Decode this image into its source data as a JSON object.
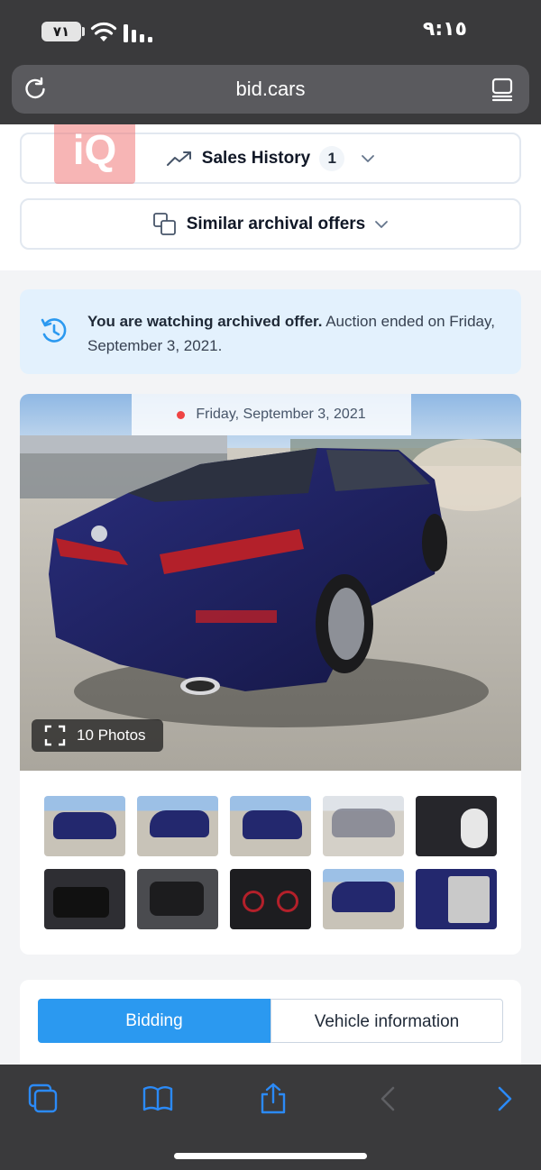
{
  "status_bar": {
    "time": "٩:١٥",
    "battery": "٧١"
  },
  "browser": {
    "url": "bid.cars"
  },
  "watermark": {
    "text": "iQ"
  },
  "sales_history": {
    "label": "Sales History",
    "count": "1"
  },
  "similar_offers": {
    "label": "Similar archival offers"
  },
  "notice": {
    "bold": "You are watching archived offer.",
    "text": " Auction ended on Friday, September 3, 2021."
  },
  "listing": {
    "date": "Friday, September 3, 2021",
    "photos_label": "10 Photos"
  },
  "tabs": [
    {
      "label": "Bidding",
      "active": true
    },
    {
      "label": "Vehicle information",
      "active": false
    }
  ],
  "colors": {
    "accent": "#2b99f0",
    "notice_bg": "#e3f1fd",
    "chrome": "#3a3a3c",
    "ios_blue": "#2b8af7"
  },
  "toolbar": {
    "icons": [
      "tabs-icon",
      "bookmarks-icon",
      "share-icon",
      "back-icon",
      "forward-icon"
    ]
  }
}
